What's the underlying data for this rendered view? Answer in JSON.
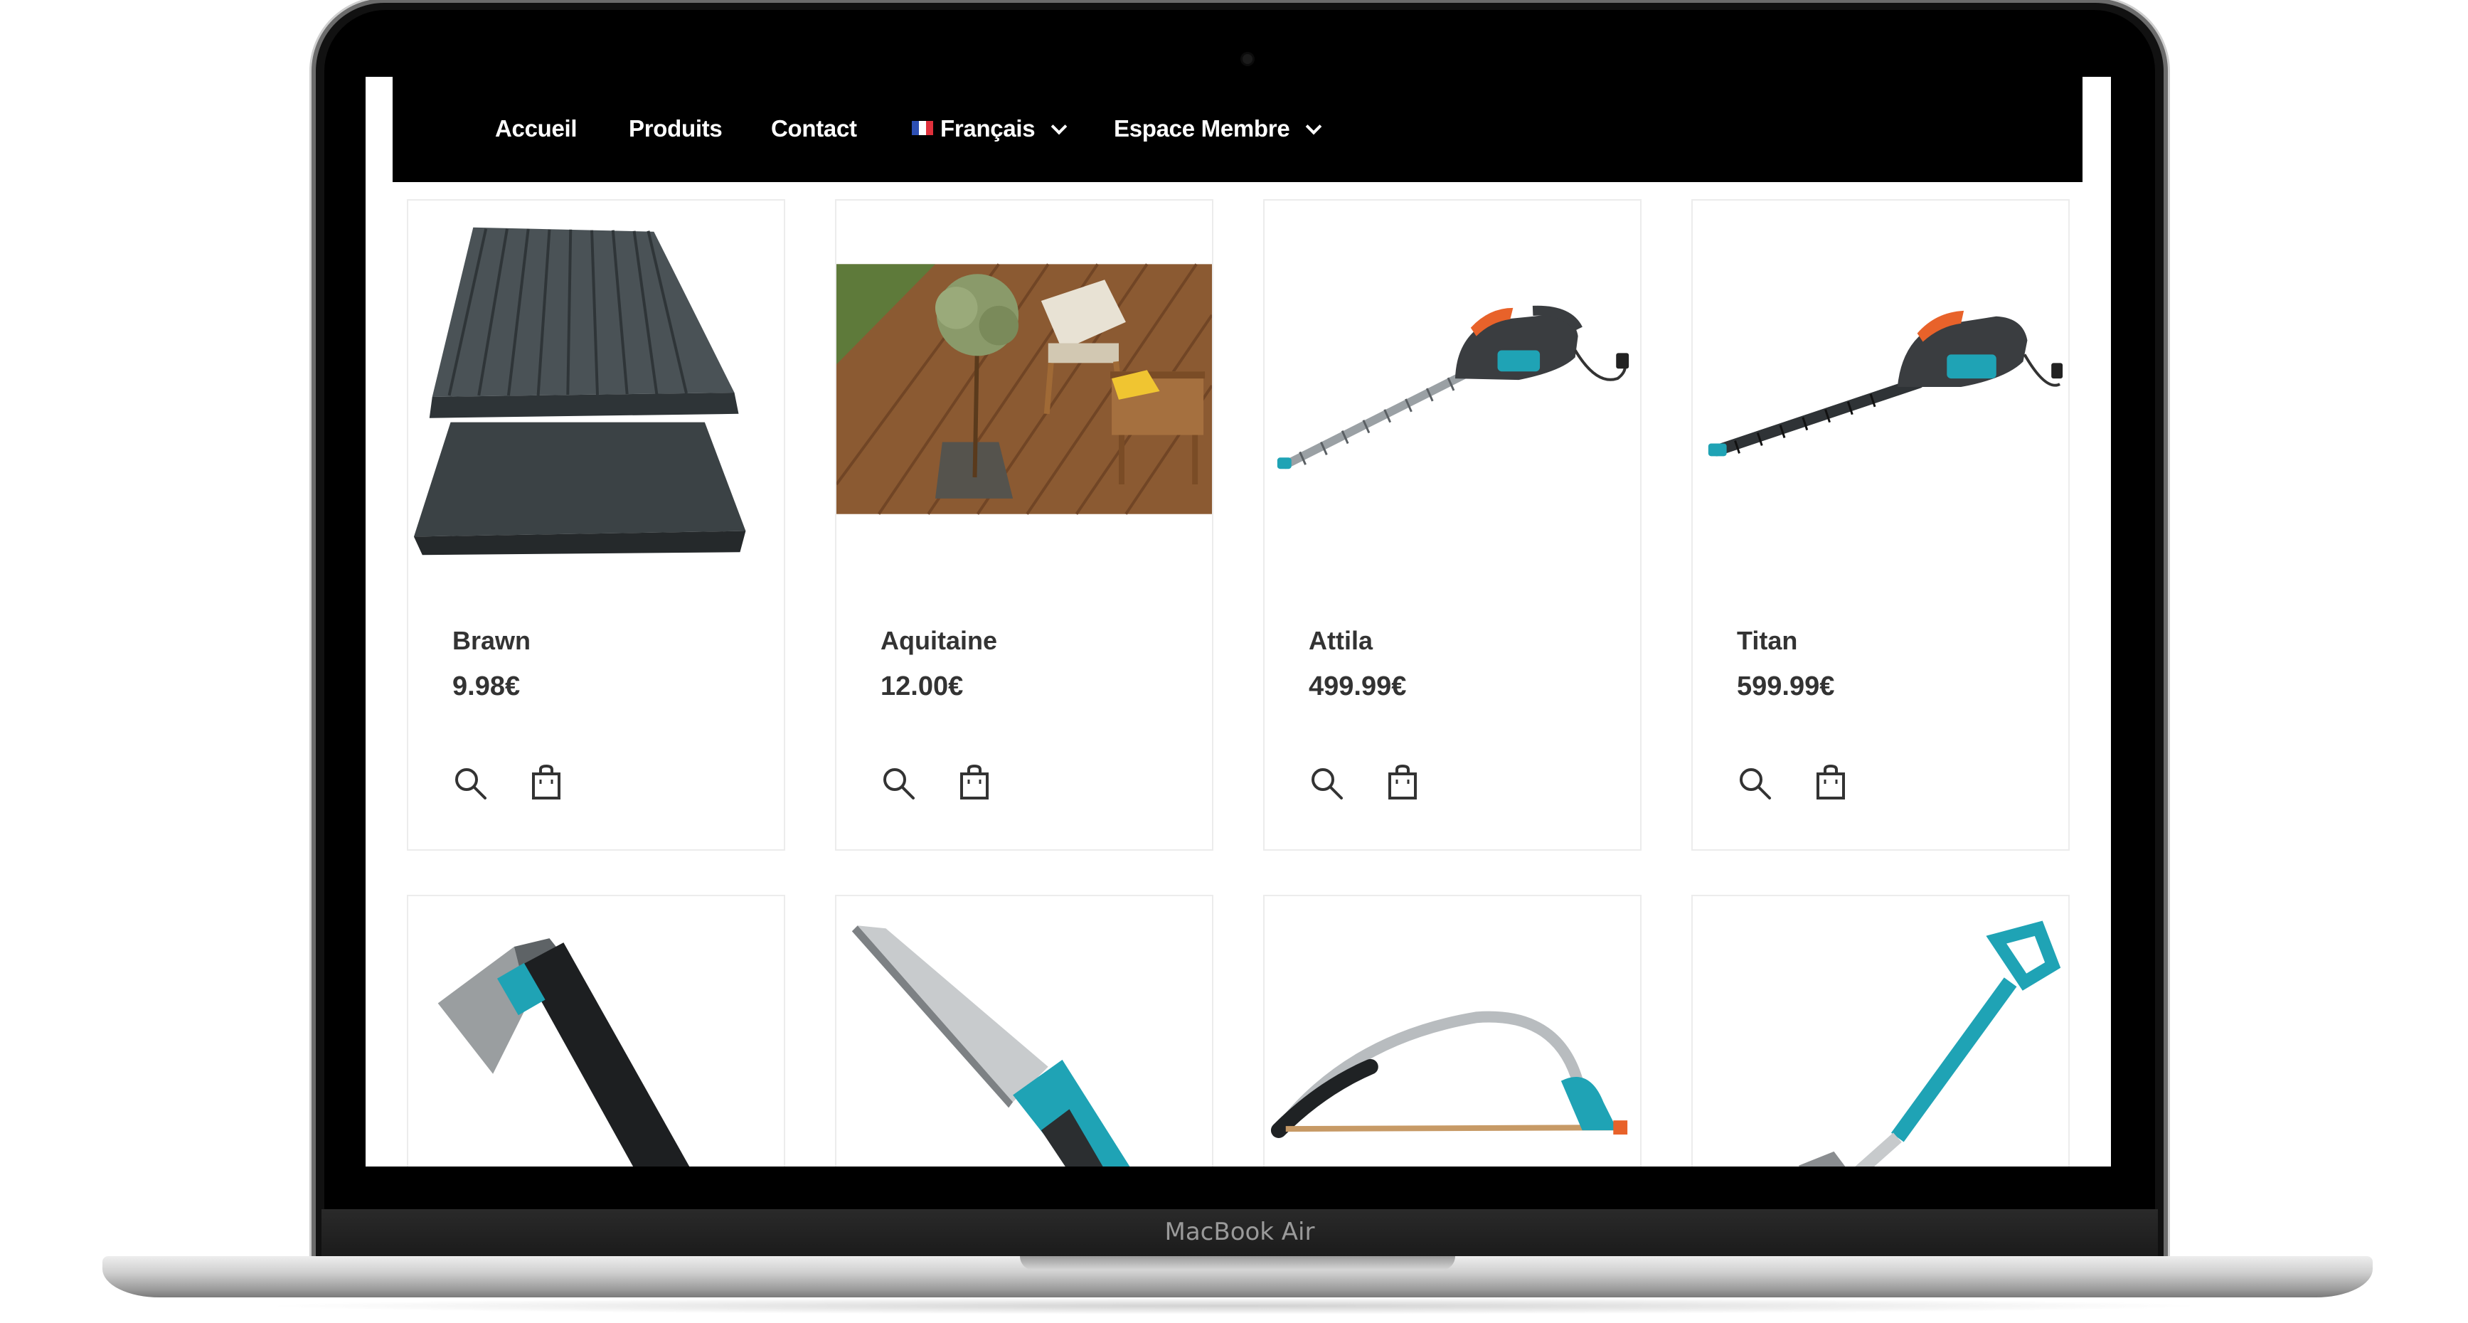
{
  "device": {
    "label": "MacBook Air"
  },
  "nav": {
    "items": [
      {
        "label": "Accueil"
      },
      {
        "label": "Produits"
      },
      {
        "label": "Contact"
      },
      {
        "label": "Français",
        "flag": "france-flag-icon",
        "dropdown": true
      },
      {
        "label": "Espace Membre",
        "dropdown": true
      }
    ]
  },
  "products": [
    {
      "name": "Brawn",
      "price": "9.98€",
      "image": "composite-decking-boards"
    },
    {
      "name": "Aquitaine",
      "price": "12.00€",
      "image": "wooden-terrace-with-chairs"
    },
    {
      "name": "Attila",
      "price": "499.99€",
      "image": "electric-hedge-trimmer"
    },
    {
      "name": "Titan",
      "price": "599.99€",
      "image": "electric-hedge-trimmer-large"
    }
  ],
  "products_row2": [
    {
      "image": "axe"
    },
    {
      "image": "pruning-saw"
    },
    {
      "image": "bow-saw"
    },
    {
      "image": "spade"
    }
  ],
  "icons": {
    "view": "search-icon",
    "cart": "shopping-bag-icon"
  },
  "colors": {
    "navbar": "#000000",
    "teal": "#1fa3b5",
    "text": "#333333"
  }
}
